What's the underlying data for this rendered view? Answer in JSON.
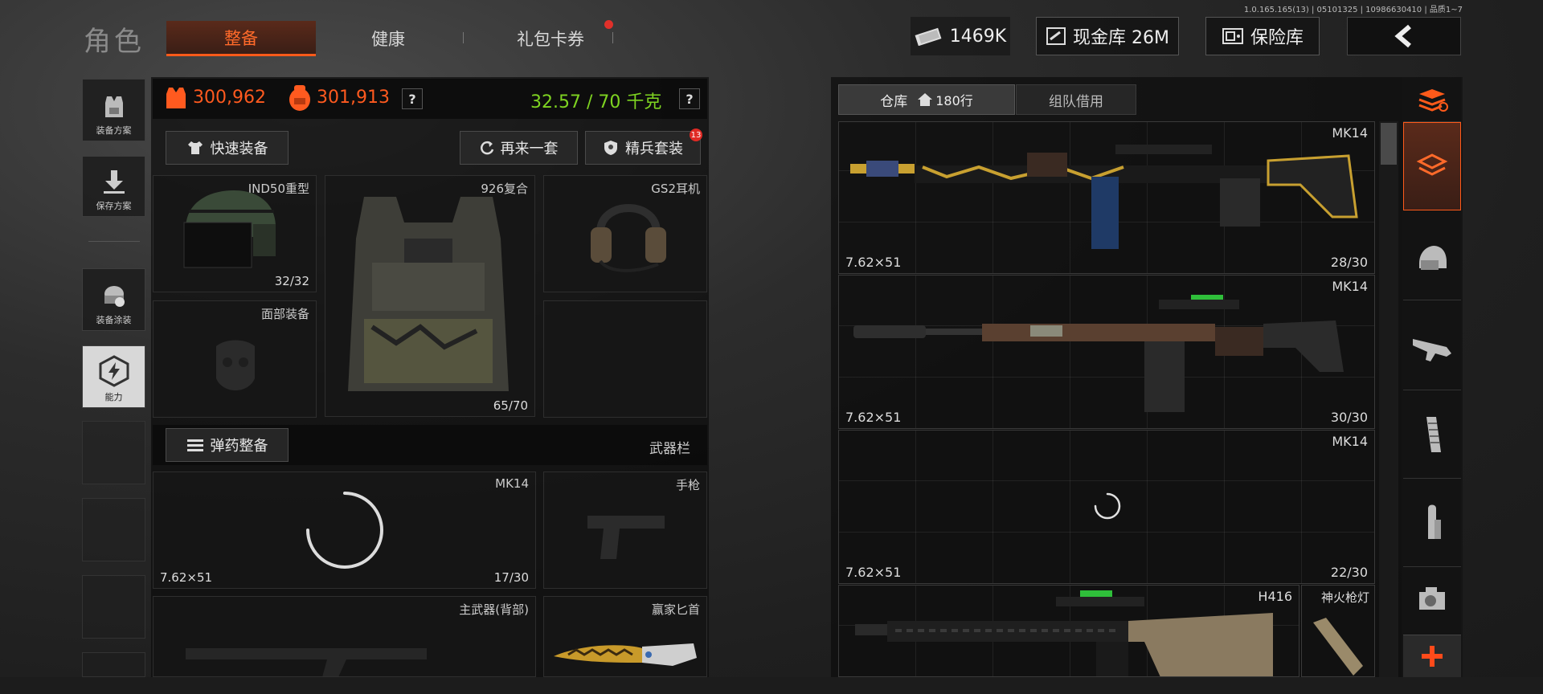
{
  "version": "1.0.165.165(13) | 05101325 | 10986630410 | 品质1~7",
  "header": {
    "title": "角色",
    "tabs": [
      {
        "label": "整备",
        "active": true
      },
      {
        "label": "健康",
        "active": false
      },
      {
        "label": "礼包卡券",
        "active": false
      }
    ],
    "money": "1469K",
    "cash_vault": "现金库 26M",
    "safe": "保险库"
  },
  "sidebar": {
    "items": [
      {
        "label": "装备方案",
        "icon": "vest-icon"
      },
      {
        "label": "保存方案",
        "icon": "download-icon"
      },
      {
        "label": "装备涂装",
        "icon": "skin-icon"
      },
      {
        "label": "能力",
        "icon": "lightning-icon"
      }
    ]
  },
  "stats": {
    "value1": "300,962",
    "value2": "301,913",
    "weight": "32.57 / 70 千克",
    "help": "?"
  },
  "buttons": {
    "quick_equip": "快速装备",
    "again": "再来一套",
    "elite": "精兵套装",
    "elite_badge": "13",
    "ammo": "弹药整备",
    "weapon_bar": "武器栏"
  },
  "slots": {
    "helmet": {
      "name": "IND50重型",
      "durability": "32/32"
    },
    "armor": {
      "name": "926复合",
      "durability": "65/70"
    },
    "headset": {
      "name": "GS2耳机"
    },
    "face": {
      "name": "面部装备"
    },
    "primary": {
      "name": "MK14",
      "caliber": "7.62×51",
      "ammo": "17/30"
    },
    "pistol": {
      "name": "手枪"
    },
    "secondary": {
      "name": "主武器(背部)"
    },
    "knife": {
      "name": "赢家匕首"
    }
  },
  "warehouse": {
    "tabs": [
      {
        "label": "仓库",
        "extra": "180行",
        "active": true
      },
      {
        "label": "组队借用",
        "active": false
      }
    ],
    "items": [
      {
        "name": "MK14",
        "caliber": "7.62×51",
        "ammo": "28/30"
      },
      {
        "name": "MK14",
        "caliber": "7.62×51",
        "ammo": "30/30"
      },
      {
        "name": "MK14",
        "caliber": "7.62×51",
        "ammo": "22/30"
      },
      {
        "name": "H416",
        "caliber": "",
        "ammo": ""
      }
    ],
    "side_item": "神火枪灯"
  },
  "categories": [
    "stack-icon",
    "layers-icon",
    "helmet-icon",
    "rifle-icon",
    "magazine-icon",
    "bullet-icon",
    "sight-icon",
    "plus-icon"
  ],
  "colors": {
    "accent": "#ff5a1a",
    "weight": "#7ed321"
  }
}
